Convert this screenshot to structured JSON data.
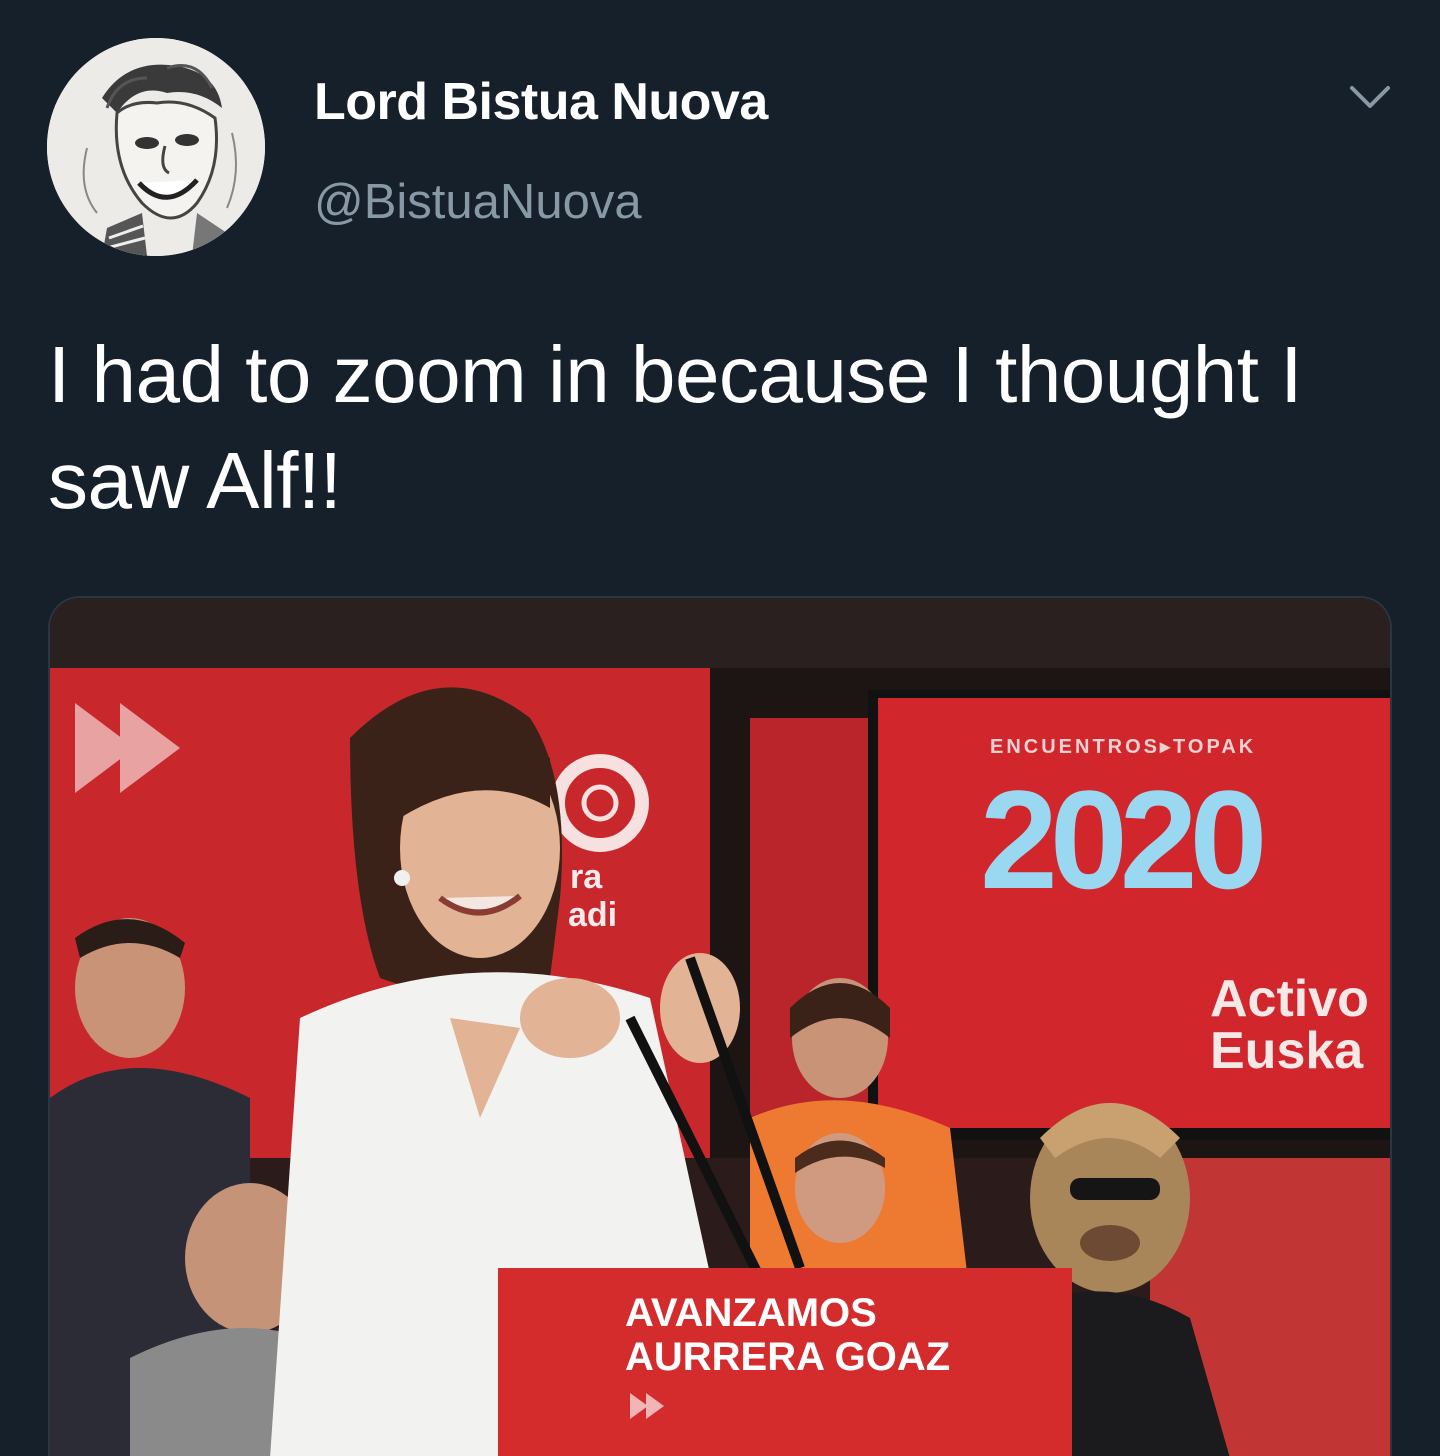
{
  "tweet": {
    "author": {
      "display_name": "Lord Bistua Nuova",
      "handle": "@BistuaNuova",
      "avatar_icon": "caricature-avatar"
    },
    "text": "I had to zoom in because I thought I saw Alf!!",
    "menu_icon": "chevron-down-icon"
  },
  "media": {
    "banner_right_top": "ENCUENTROS▸TOPAK",
    "banner_right_year": "2020",
    "banner_right_line1": "Activo",
    "banner_right_line2": "Euska",
    "banner_left_line1": "ra",
    "banner_left_line2": "adi",
    "podium_line1": "AVANZAMOS",
    "podium_line2": "AURRERA GOAZ"
  },
  "colors": {
    "background": "#15202b",
    "secondary_text": "#8899a6",
    "banner_red": "#d5202a"
  }
}
